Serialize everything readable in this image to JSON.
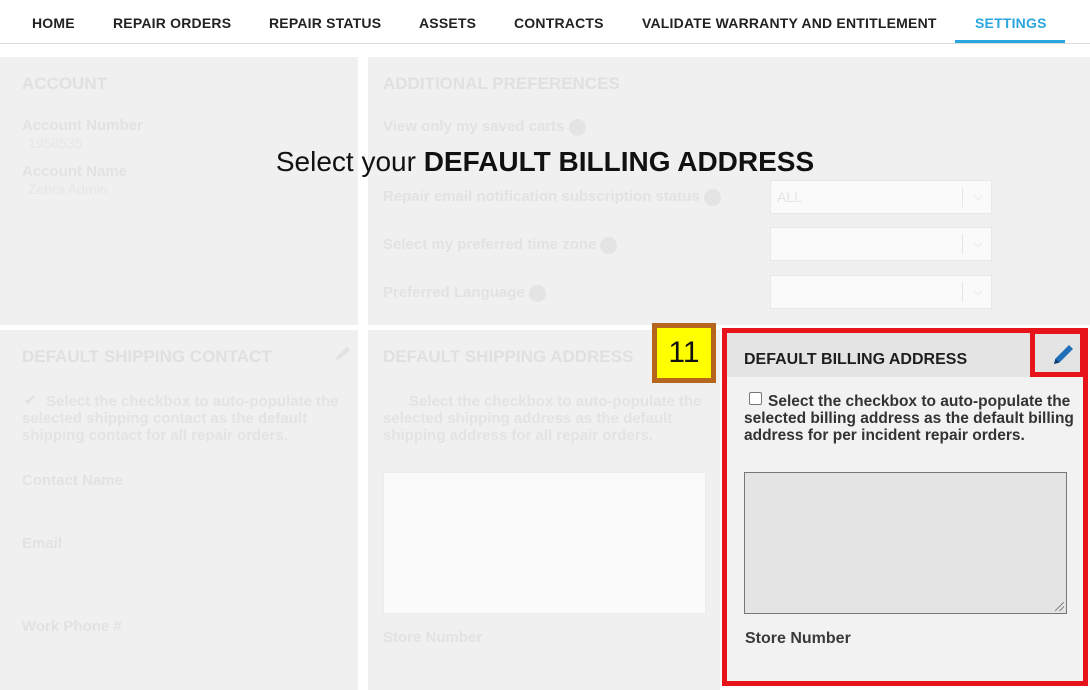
{
  "nav": {
    "items": [
      {
        "label": "HOME"
      },
      {
        "label": "REPAIR ORDERS"
      },
      {
        "label": "REPAIR STATUS"
      },
      {
        "label": "ASSETS"
      },
      {
        "label": "CONTRACTS"
      },
      {
        "label": "VALIDATE WARRANTY AND ENTITLEMENT"
      },
      {
        "label": "SETTINGS"
      }
    ],
    "active": "SETTINGS"
  },
  "account": {
    "title": "ACCOUNT",
    "number_label": "Account Number",
    "number_value": "1958535",
    "name_label": "Account Name",
    "name_value": "Zebra Admin"
  },
  "preferences": {
    "title": "ADDITIONAL PREFERENCES",
    "saved_carts_label": "View only my saved carts",
    "email_subscription_label": "Repair email notification subscription status",
    "email_subscription_value": "ALL",
    "time_zone_label": "Select my preferred time zone",
    "time_zone_value": "",
    "language_label": "Preferred Language",
    "language_value": ""
  },
  "headline": {
    "prefix": "Select your ",
    "emphasis": "DEFAULT BILLING ADDRESS"
  },
  "shipping_contact": {
    "title": "DEFAULT SHIPPING CONTACT",
    "checkbox_text": "Select the checkbox to auto-populate the selected shipping contact as the default shipping contact for all repair orders.",
    "contact_name_label": "Contact Name",
    "email_label": "Email",
    "work_phone_label": "Work Phone #"
  },
  "shipping_address": {
    "title": "DEFAULT SHIPPING ADDRESS",
    "checkbox_text": "Select the checkbox to auto-populate the selected shipping address as the default shipping address for all repair orders.",
    "store_number_label": "Store Number"
  },
  "billing": {
    "title": "DEFAULT BILLING ADDRESS",
    "checkbox_text": "Select the checkbox to auto-populate the selected billing address as the default billing address for per incident repair orders.",
    "checked": false,
    "address_value": "",
    "store_number_label": "Store Number"
  },
  "step_badge": "11",
  "colors": {
    "accent": "#2aa6de",
    "highlight": "#e8141b",
    "badge_fill": "#ffff00",
    "badge_border": "#b5651d",
    "pencil": "#1f6fb8"
  }
}
